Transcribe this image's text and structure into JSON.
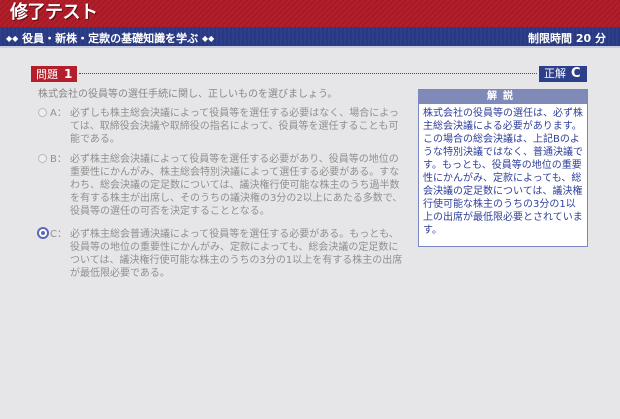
{
  "header": {
    "logo": "修了テスト",
    "subtitle": "役員・新株・定款の基礎知識を学ぶ",
    "timer_label": "制限時間 20 分"
  },
  "question": {
    "label": "問題",
    "number": "1",
    "text": "株式会社の役員等の選任手続に関し、正しいものを選びましょう。"
  },
  "answer": {
    "label": "正解",
    "value": "C"
  },
  "options": [
    {
      "letter": "A：",
      "text": "必ずしも株主総会決議によって役員等を選任する必要はなく、場合によっては、取締役会決議や取締役の指名によって、役員等を選任することも可能である。"
    },
    {
      "letter": "B：",
      "text": "必ず株主総会決議によって役員等を選任する必要があり、役員等の地位の重要性にかんがみ、株主総会特別決議によって選任する必要がある。すなわち、総会決議の定足数については、議決権行使可能な株主のうち過半数を有する株主が出席し、そのうちの議決権の3分の2以上にあたる多数で、役員等の選任の可否を決定することとなる。"
    },
    {
      "letter": "C：",
      "text": "必ず株主総会普通決議によって役員等を選任する必要がある。もっとも、役員等の地位の重要性にかんがみ、定款によっても、総会決議の定足数については、議決権行使可能な株主のうちの3分の1以上を有する株主の出席が最低限必要である。"
    }
  ],
  "selected_option": "C",
  "explanation": {
    "title": "解説",
    "text": "株式会社の役員等の選任は、必ず株主総会決議による必要があります。この場合の総会決議は、上記Bのような特別決議ではなく、普通決議です。もっとも、役員等の地位の重要性にかんがみ、定款によっても、総会決議の定足数については、議決権行使可能な株主のうちの3分の1以上の出席が最低限必要とされています。"
  },
  "colors": {
    "header_red": "#b3202c",
    "header_blue": "#2d3f8a",
    "explanation_text": "#2f3f9a"
  }
}
